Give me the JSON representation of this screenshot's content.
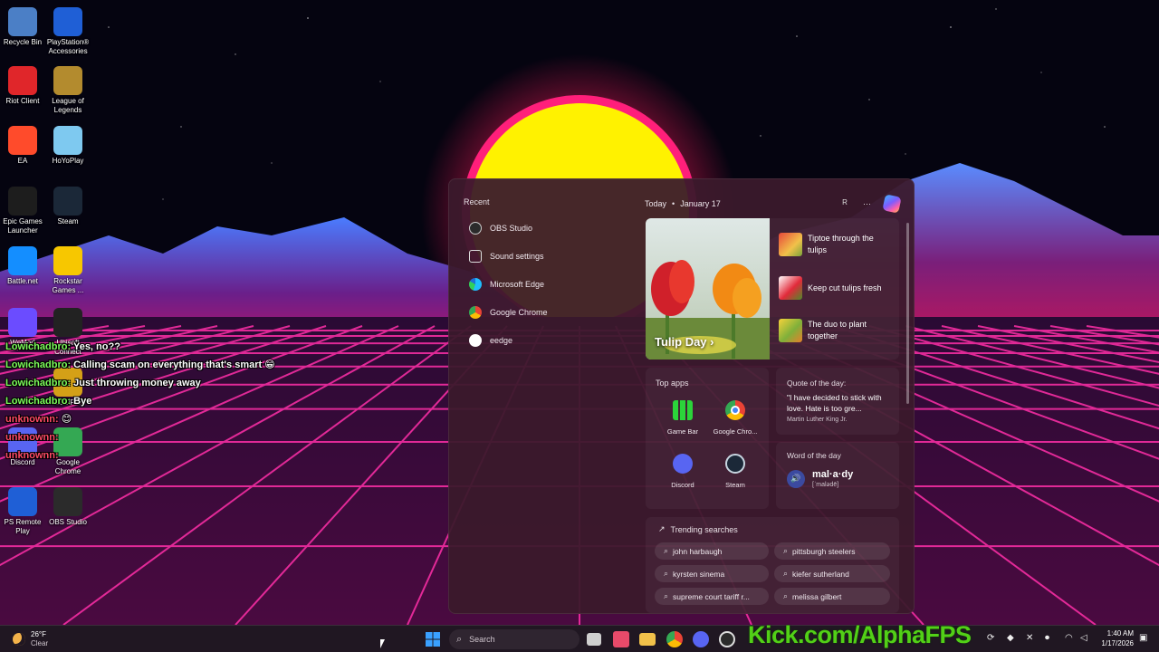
{
  "desktop": {
    "icons": [
      {
        "label": "Recycle Bin",
        "icon": "recycle-bin-icon",
        "color": "#4b7fc6"
      },
      {
        "label": "PlayStation® Accessories",
        "icon": "playstation-accessories-icon",
        "color": "#1f5fd6"
      },
      {
        "label": "Riot Client",
        "icon": "riot-client-icon",
        "color": "#e0262a"
      },
      {
        "label": "League of Legends",
        "icon": "league-of-legends-icon",
        "color": "#b38b2e"
      },
      {
        "label": "EA",
        "icon": "ea-icon",
        "color": "#ff4b2b"
      },
      {
        "label": "HoYoPlay",
        "icon": "hoyoplay-icon",
        "color": "#7ec9f0"
      },
      {
        "label": "Epic Games Launcher",
        "icon": "epic-games-icon",
        "color": "#1d1d1d"
      },
      {
        "label": "Steam",
        "icon": "steam-icon",
        "color": "#1b2838"
      },
      {
        "label": "Battle.net",
        "icon": "battlenet-icon",
        "color": "#148eff"
      },
      {
        "label": "Rockstar Games ...",
        "icon": "rockstar-icon",
        "color": "#f7c700"
      },
      {
        "label": "WeMod",
        "icon": "wemod-icon",
        "color": "#6b4cff"
      },
      {
        "label": "Ubisoft Connect",
        "icon": "ubisoft-icon",
        "color": "#222222"
      },
      {
        "label": "EDOPro",
        "icon": "edopro-icon",
        "color": "#d4a017"
      },
      {
        "label": "Discord",
        "icon": "discord-icon",
        "color": "#5865f2"
      },
      {
        "label": "Google Chrome",
        "icon": "chrome-icon",
        "color": "#34a853"
      },
      {
        "label": "PS Remote Play",
        "icon": "ps-remote-play-icon",
        "color": "#1f5fd6"
      },
      {
        "label": "OBS Studio",
        "icon": "obs-icon",
        "color": "#2b2b2b"
      }
    ]
  },
  "chat": {
    "lines": [
      {
        "user": "Lowichadbro:",
        "msg": "Yes, no??",
        "user_color": "green"
      },
      {
        "user": "Lowichadbro:",
        "msg": "Calling scam on everything that's smart 😁",
        "user_color": "green"
      },
      {
        "user": "Lowichadbro:",
        "msg": "Just throwing money away",
        "user_color": "green"
      },
      {
        "user": "Lowichadbro:",
        "msg": "Bye",
        "user_color": "green"
      },
      {
        "user": "unknownn:",
        "msg": "😊",
        "user_color": "red"
      },
      {
        "user": "unknownn:",
        "msg": "",
        "user_color": "red"
      },
      {
        "user": "unknownn:",
        "msg": "",
        "user_color": "red"
      }
    ]
  },
  "panel": {
    "recent": {
      "title": "Recent",
      "items": [
        {
          "label": "OBS Studio",
          "icon": "obs-icon"
        },
        {
          "label": "Sound settings",
          "icon": "speaker-icon"
        },
        {
          "label": "Microsoft Edge",
          "icon": "edge-icon"
        },
        {
          "label": "Google Chrome",
          "icon": "chrome-icon"
        },
        {
          "label": "eedge",
          "icon": "search-icon"
        }
      ]
    },
    "header": {
      "today": "Today",
      "separator": "•",
      "date": "January 17",
      "avatar": "R",
      "more": "···"
    },
    "feature": {
      "title": "Tulip Day",
      "chevron": "›",
      "stories": [
        {
          "text": "Tiptoe through the tulips"
        },
        {
          "text": "Keep cut tulips fresh"
        },
        {
          "text": "The duo to plant together"
        }
      ]
    },
    "top_apps": {
      "title": "Top apps",
      "apps": [
        {
          "label": "Game Bar",
          "icon": "game-bar-icon"
        },
        {
          "label": "Google Chro...",
          "icon": "chrome-icon"
        },
        {
          "label": "Discord",
          "icon": "discord-icon"
        },
        {
          "label": "Steam",
          "icon": "steam-icon"
        }
      ]
    },
    "quote": {
      "title": "Quote of the day:",
      "text": "\"I have decided to stick with love. Hate is too gre...",
      "author": "Martin Luther King Jr."
    },
    "word": {
      "title": "Word of the day",
      "word": "mal·a·dy",
      "pron": "[ˈmalədē]"
    },
    "trending": {
      "title": "Trending searches",
      "items": [
        "john harbaugh",
        "pittsburgh steelers",
        "kyrsten sinema",
        "kiefer sutherland",
        "supreme court tariff r...",
        "melissa gilbert"
      ]
    }
  },
  "taskbar": {
    "weather_temp": "26°F",
    "weather_cond": "Clear",
    "search_placeholder": "Search",
    "overlay_text": "Kick.com/AlphaFPS",
    "time": "1:40 AM",
    "date": "1/17/2026"
  },
  "colors": {
    "panel_bg": "#3a1a2c",
    "kick_green": "#52d017",
    "grid_pink": "#ff2fa8",
    "sun_yellow": "#fff200"
  }
}
